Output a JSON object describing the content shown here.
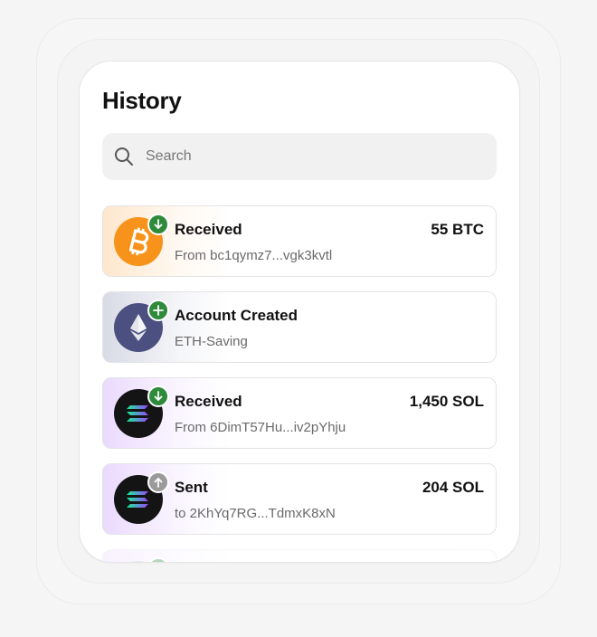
{
  "history": {
    "title": "History",
    "search": {
      "placeholder": "Search"
    },
    "items": [
      {
        "asset": "bitcoin",
        "status": "received",
        "label": "Received",
        "detail": "From bc1qymz7...vgk3kvtl",
        "amount": "55 BTC"
      },
      {
        "asset": "ethereum",
        "status": "created",
        "label": "Account Created",
        "detail": "ETH-Saving",
        "amount": ""
      },
      {
        "asset": "solana",
        "status": "received",
        "label": "Received",
        "detail": "From 6DimT57Hu...iv2pYhju",
        "amount": "1,450 SOL"
      },
      {
        "asset": "solana",
        "status": "sent",
        "label": "Sent",
        "detail": "to 2KhYq7RG...TdmxK8xN",
        "amount": "204 SOL"
      }
    ]
  },
  "colors": {
    "bitcoin": "#f7931a",
    "ethereum": "#4b5080",
    "solana_bg": "#141414",
    "badge_green": "#2f8a3c",
    "badge_grey": "#9a9a9a"
  }
}
